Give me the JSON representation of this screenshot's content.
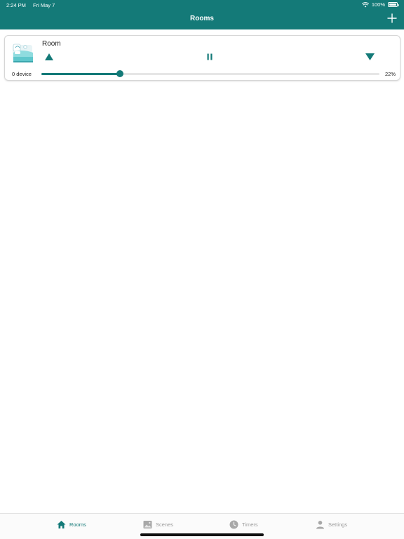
{
  "status_bar": {
    "time": "2:24 PM",
    "date": "Fri May 7",
    "battery": "100%"
  },
  "header": {
    "title": "Rooms",
    "add_icon": "plus-icon"
  },
  "room": {
    "name": "Room",
    "devices": "0 device",
    "position_percent": "22%",
    "position_value": 22,
    "icons": {
      "room": "bed-icon",
      "open": "triangle-up-icon",
      "stop": "pause-icon",
      "close": "triangle-down-icon"
    }
  },
  "tabs": [
    {
      "label": "Rooms",
      "icon": "home-icon",
      "active": true
    },
    {
      "label": "Scenes",
      "icon": "image-icon",
      "active": false
    },
    {
      "label": "Timers",
      "icon": "clock-icon",
      "active": false
    },
    {
      "label": "Settings",
      "icon": "person-icon",
      "active": false
    }
  ],
  "colors": {
    "accent": "#147a78",
    "inactive": "#9a9a9a"
  }
}
